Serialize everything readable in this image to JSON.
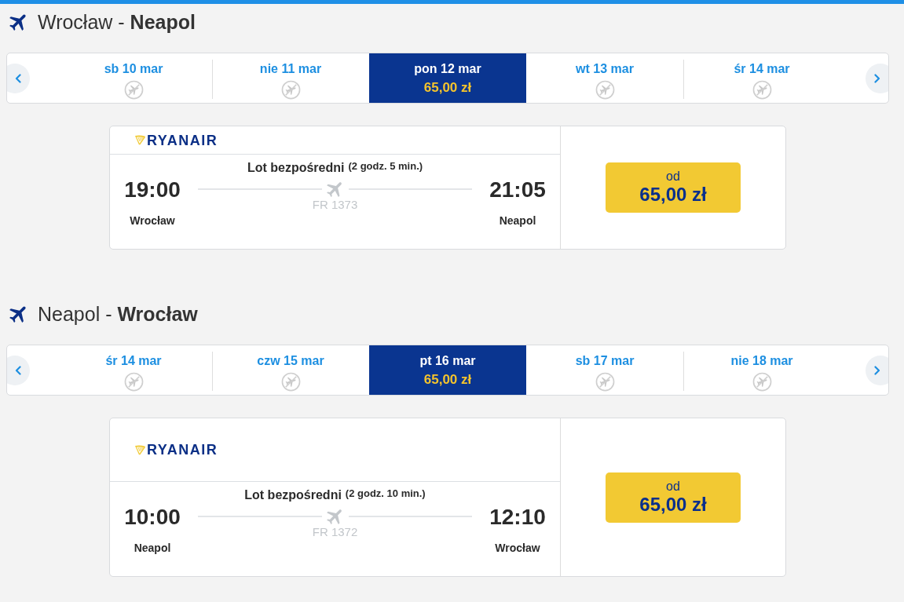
{
  "sections": [
    {
      "title": "Wrocław - **Neapol**",
      "dates": [
        {
          "label": "sb 10 mar",
          "selected": false,
          "available": false
        },
        {
          "label": "nie 11 mar",
          "selected": false,
          "available": false
        },
        {
          "label": "pon 12 mar",
          "selected": true,
          "available": true,
          "price": "65,00 zł"
        },
        {
          "label": "wt 13 mar",
          "selected": false,
          "available": false
        },
        {
          "label": "śr 14 mar",
          "selected": false,
          "available": false
        }
      ],
      "flight": {
        "airline": "RYANAIR",
        "connection": "Lot bezpośredni",
        "duration": "(2 godz. 5 min.)",
        "departure_time": "19:00",
        "origin": "Wrocław",
        "flight_number": "FR 1373",
        "arrival_time": "21:05",
        "destination": "Neapol",
        "price_label": "od",
        "price": "65,00 zł"
      }
    },
    {
      "title": "Neapol - **Wrocław**",
      "dates": [
        {
          "label": "śr 14 mar",
          "selected": false,
          "available": false
        },
        {
          "label": "czw 15 mar",
          "selected": false,
          "available": false
        },
        {
          "label": "pt 16 mar",
          "selected": true,
          "available": true,
          "price": "65,00 zł"
        },
        {
          "label": "sb 17 mar",
          "selected": false,
          "available": false
        },
        {
          "label": "nie 18 mar",
          "selected": false,
          "available": false
        }
      ],
      "flight": {
        "airline": "RYANAIR",
        "connection": "Lot bezpośredni",
        "duration": "(2 godz. 10 min.)",
        "departure_time": "10:00",
        "origin": "Neapol",
        "flight_number": "FR 1372",
        "arrival_time": "12:10",
        "destination": "Wrocław",
        "price_label": "od",
        "price": "65,00 zł"
      }
    }
  ]
}
